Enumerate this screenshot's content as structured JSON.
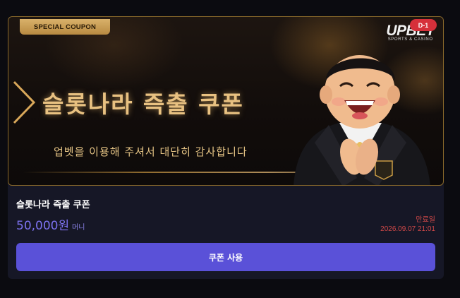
{
  "banner": {
    "tag": "SPECIAL COUPON",
    "title": "슬롯나라 즉출 쿠폰",
    "subtitle": "업벳을 이용해 주셔서 대단히 감사합니다",
    "brand_name": "UPBET",
    "brand_sub": "SPORTS & CASINO",
    "d_day": "D-1"
  },
  "coupon": {
    "name": "슬롯나라 즉출 쿠폰",
    "amount": "50,000원",
    "amount_unit": "머니",
    "expiry_label": "만료일",
    "expiry_date": "2026.09.07 21:01"
  },
  "actions": {
    "use_label": "쿠폰 사용"
  },
  "colors": {
    "accent": "#5a51d8",
    "amount": "#7c72f0",
    "expiry": "#d04848",
    "gold": "#e8c181",
    "badge": "#d6303a"
  }
}
